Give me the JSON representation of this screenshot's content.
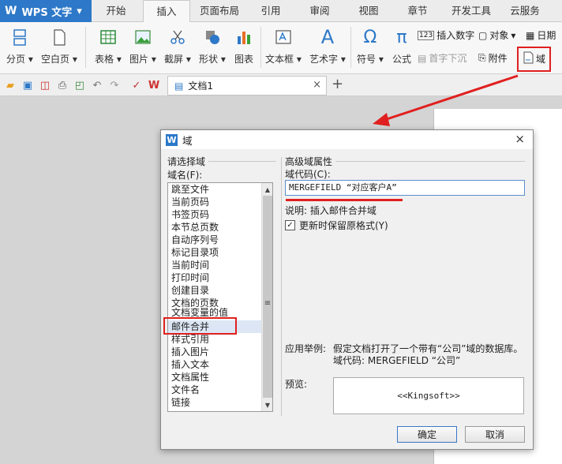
{
  "app": {
    "logo_text": "WPS 文字",
    "menu_arrow": "▾"
  },
  "tabs": [
    "开始",
    "插入",
    "页面布局",
    "引用",
    "审阅",
    "视图",
    "章节",
    "开发工具",
    "云服务"
  ],
  "active_tab": "插入",
  "ribbon": {
    "page_break": "分页",
    "blank_page": "空白页",
    "table": "表格",
    "picture": "图片",
    "screenshot": "截屏",
    "shape": "形状",
    "chart": "图表",
    "textbox": "文本框",
    "wordart": "艺术字",
    "symbol": "符号",
    "formula": "公式",
    "insert_number": "插入数字",
    "object": "对象",
    "date": "日期",
    "drop_cap": "首字下沉",
    "attachment": "附件",
    "field": "域"
  },
  "document_tab": {
    "name": "文档1",
    "close": "×"
  },
  "new_tab": "+",
  "dialog": {
    "title": "域",
    "close": "×",
    "left_group_label": "请选择域",
    "field_name_label": "域名(F):",
    "fields": [
      "跳至文件",
      "当前页码",
      "书签页码",
      "本节总页数",
      "自动序列号",
      "标记目录项",
      "当前时间",
      "打印时间",
      "创建目录",
      "文档的页数",
      "文档变量的值",
      "邮件合并",
      "样式引用",
      "插入图片",
      "插入文本",
      "文档属性",
      "文件名",
      "链接"
    ],
    "selected_field": "邮件合并",
    "right_group_label": "高级域属性",
    "field_code_label": "域代码(C):",
    "field_code_value": "MERGEFIELD “对应客户A”",
    "description": "说明: 插入邮件合并域",
    "preserve_format_label": "更新时保留原格式(Y)",
    "preserve_format_checked": true,
    "example_label": "应用举例:",
    "example_line1": "假定文档打开了一个带有“公司”域的数据库。",
    "example_line2": "域代码: MERGEFIELD “公司”",
    "preview_label": "预览:",
    "preview_value": "<<Kingsoft>>",
    "ok": "确定",
    "cancel": "取消"
  },
  "colors": {
    "accent": "#2d78c8",
    "highlight": "#e02020"
  }
}
